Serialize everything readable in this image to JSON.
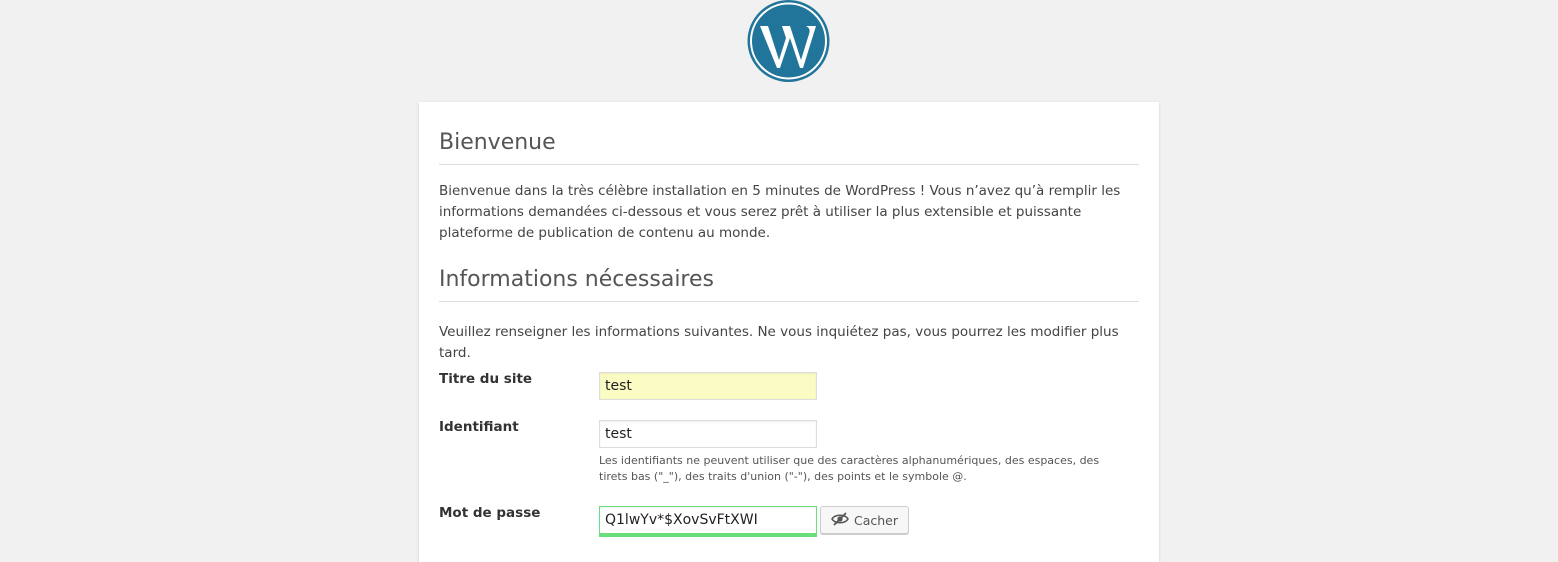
{
  "colors": {
    "background": "#f1f1f1",
    "card": "#ffffff",
    "wordpress_blue": "#21759b",
    "autofill_yellow": "#fbfcc3",
    "strong_password_green": "#68de7c"
  },
  "logo": {
    "icon": "wordpress-logo-icon"
  },
  "welcome": {
    "heading": "Bienvenue",
    "text": "Bienvenue dans la très célèbre installation en 5 minutes de WordPress ! Vous n’avez qu’à remplir les informations demandées ci-dessous et vous serez prêt à utiliser la plus extensible et puissante plateforme de publication de contenu au monde."
  },
  "info": {
    "heading": "Informations nécessaires",
    "text": "Veuillez renseigner les informations suivantes. Ne vous inquiétez pas, vous pourrez les modifier plus tard."
  },
  "form": {
    "site_title": {
      "label": "Titre du site",
      "value": "test"
    },
    "username": {
      "label": "Identifiant",
      "value": "test",
      "help": "Les identifiants ne peuvent utiliser que des caractères alphanumériques, des espaces, des tirets bas (\"_\"), des traits d'union (\"-\"), des points et le symbole @."
    },
    "password": {
      "label": "Mot de passe",
      "value": "Q1lwYv*$XovSvFtXWI",
      "toggle_label": "Cacher",
      "toggle_icon": "eye-slash-icon"
    }
  }
}
